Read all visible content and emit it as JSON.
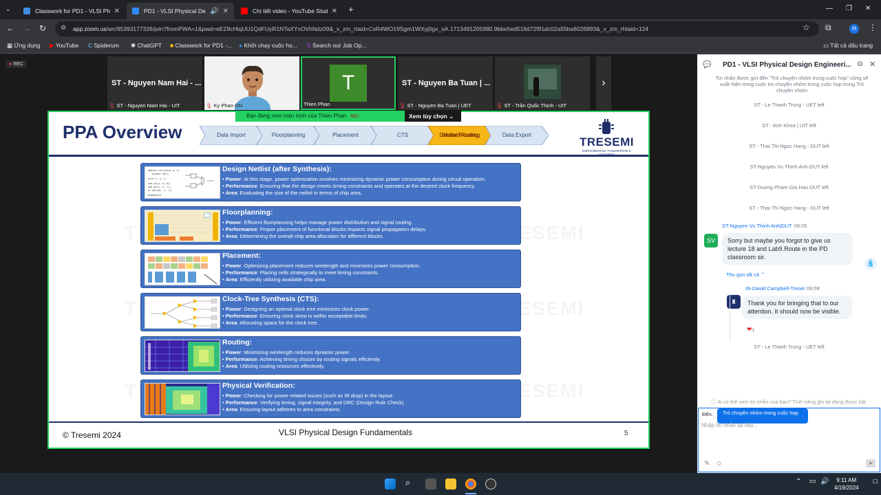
{
  "browser": {
    "tabs": [
      {
        "title": "Classwork for PD1 - VLSI Physic",
        "color": "#3c8de0"
      },
      {
        "title": "PD1 - VLSI Physical Design",
        "color": "#2d8cff"
      },
      {
        "title": "Chi tiết video - YouTube Studio",
        "color": "#ff0000"
      }
    ],
    "url_host": "app.zoom.us",
    "url_rest": "/wc/95393177326/join?fromPWA=1&pwd=eEZ8cHlqUU1QdFUyR1NTaXYxOVhNdz09&_x_zm_rtaid=CsR4WO19Sgm1WXyj0gx_oA.1713491205980.9bbe5ed516d72f91dc02a55ba6026893&_x_zm_rhtaid=124",
    "bookmarks": [
      "Ứng dụng",
      "YouTube",
      "Spiderum",
      "ChatGPT",
      "Classwork for PD1 -...",
      "Khởi chạy cuộc họ...",
      "Search our Job Op..."
    ],
    "all_bookmarks": "Tất cả dấu trang",
    "profile_initial": "H"
  },
  "zoom": {
    "rec": "REC",
    "participants": [
      {
        "big": "ST - Nguyen Nam Hai - ...",
        "label": "ST - Nguyen Nam Hai - UIT",
        "muted": true
      },
      {
        "big": "",
        "label": "Ky Phan-DN",
        "muted": true
      },
      {
        "big": "T",
        "label": "Thien Phan",
        "muted": false
      },
      {
        "big": "ST - Nguyen Ba Tuan | ...",
        "label": "ST - Nguyen Ba Tuan | UET",
        "muted": true
      },
      {
        "big": "",
        "label": "ST - Trần Quốc Thịnh - UIT",
        "muted": true
      }
    ],
    "banner": "Bạn đang xem màn hình của  Thien Phan",
    "banner_rec": "REC",
    "view_options": "Xem tùy chọn"
  },
  "slide": {
    "title": "PPA Overview",
    "steps": [
      "Data Import",
      "Floorplanning",
      "Placement",
      "CTS",
      "Global Routing",
      "Detailed Routing",
      "Data Export"
    ],
    "logo_name": "TRESEMI",
    "logo_tag": "EMPOWERING TOMORROW'S LEADERS",
    "watermark": "TRESEMI",
    "footer_left": "© Tresemi 2024",
    "footer_center": "VLSI Physical Design Fundamentals",
    "page": "5",
    "cards": [
      {
        "heading": "Design Netlist (after Synthesis):",
        "power": "At this stage, power optimization involves minimizing dynamic power consumption during circuit operation.",
        "performance": "Ensuring that the design meets timing constraints and operates at the desired clock frequency.",
        "area": "Evaluating the size of the netlist in terms of chip area."
      },
      {
        "heading": "Floorplanning:",
        "power": "Efficient floorplanning helps manage power distribution and signal routing.",
        "performance": "Proper placement of functional blocks impacts signal propagation delays.",
        "area": "Determining the overall chip area allocation for different blocks."
      },
      {
        "heading": "Placement:",
        "power": "Optimizing placement reduces wirelength and minimizes power consumption.",
        "performance": "Placing cells strategically to meet timing constraints.",
        "area": "Efficiently utilizing available chip area."
      },
      {
        "heading": "Clock-Tree Synthesis (CTS):",
        "power": "Designing an optimal clock tree minimizes clock power.",
        "performance": "Ensuring clock skew is within acceptable limits.",
        "area": "Allocating space for the clock tree."
      },
      {
        "heading": "Routing:",
        "power": "Minimizing wirelength reduces dynamic power.",
        "performance": "Achieving timing closure by routing signals efficiently.",
        "area": "Utilizing routing resources effectively."
      },
      {
        "heading": "Physical Verification:",
        "power": "Checking for power-related issues (such as IR drop) in the layout.",
        "performance": "Verifying timing, signal integrity, and DRC (Design Rule Check).",
        "area": "Ensuring layout adheres to area constraints."
      }
    ],
    "labels": {
      "power": "Power",
      "performance": "Performance",
      "area": "Area"
    }
  },
  "chat": {
    "title": "PD1 - VLSI Physical Design Engineeri...",
    "note": "Tin nhắn được gửi đến \"Trò chuyện nhóm trong cuộc họp\" cũng sẽ xuất hiện trong cuộc trò chuyện nhóm trong cuộc họp trong Trò chuyện nhóm",
    "system": [
      "ST - Le Thanh Trung - UET left",
      "ST - Anh Khoa | UIT left",
      "ST - Thai Thi Ngoc Hang - DUT left",
      "ST-Nguyen Vu Thinh Anh-DUT left",
      "ST-Duong Pham Gia Hao-DUT left",
      "ST - Thai Thi Ngoc Hang - DUT left"
    ],
    "msg1_name": "ST-Nguyen Vu Thinh Anh|DUT",
    "msg1_time": "09:05",
    "msg1_initials": "SV",
    "msg1_text": "Sorry but maybe you forgot to give us lecture 18 and Lab9.Route in the PD classroom sir.",
    "collapse": "Thu gọn tất cả",
    "reply_name": "IN-David Campbell-Tresei",
    "reply_time": "09:08",
    "reply_text": "Thank you for bringing that to our attention. It should now be visible.",
    "reaction_count": "1",
    "system_last": "ST - Le Thanh Trung - UET left",
    "compose_hint": "Ai có thể xem tin nhắn của bạn? Tính năng ghi lại đang được bật",
    "to_label": "Đến:",
    "to_value": "Trò chuyện nhóm trong cuộc họp",
    "placeholder": "Nhập tin nhắn tại đây..."
  },
  "taskbar": {
    "time": "9:11 AM",
    "date": "4/19/2024"
  }
}
